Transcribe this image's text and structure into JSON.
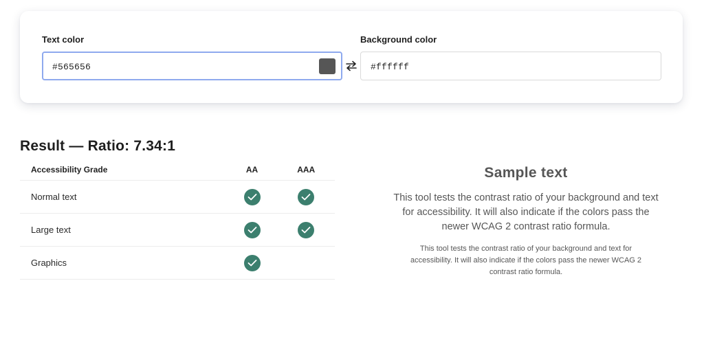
{
  "inputs": {
    "text_color_label": "Text color",
    "text_color_value": "#565656",
    "background_color_label": "Background color",
    "background_color_value": "#ffffff"
  },
  "swap_icon": "swap-arrows-icon",
  "result": {
    "title": "Result — Ratio: 7.34:1"
  },
  "table": {
    "headers": [
      "Accessibility Grade",
      "AA",
      "AAA"
    ],
    "rows": [
      {
        "name": "Normal text",
        "aa": true,
        "aaa": true
      },
      {
        "name": "Large text",
        "aa": true,
        "aaa": true
      },
      {
        "name": "Graphics",
        "aa": true,
        "aaa": false
      }
    ],
    "pass_icon": "check-circle-icon"
  },
  "sample": {
    "title": "Sample text",
    "large": "This tool tests the contrast ratio of your background and text for accessibility. It will also indicate if the colors pass the newer WCAG 2 contrast ratio formula.",
    "small": "This tool tests the contrast ratio of your background and text for accessibility. It will also indicate if the colors pass the newer WCAG 2 contrast ratio formula."
  },
  "colors": {
    "text": "#565656",
    "background": "#ffffff",
    "pass": "#3c7f6e",
    "focus_border": "#8ea9ee"
  }
}
